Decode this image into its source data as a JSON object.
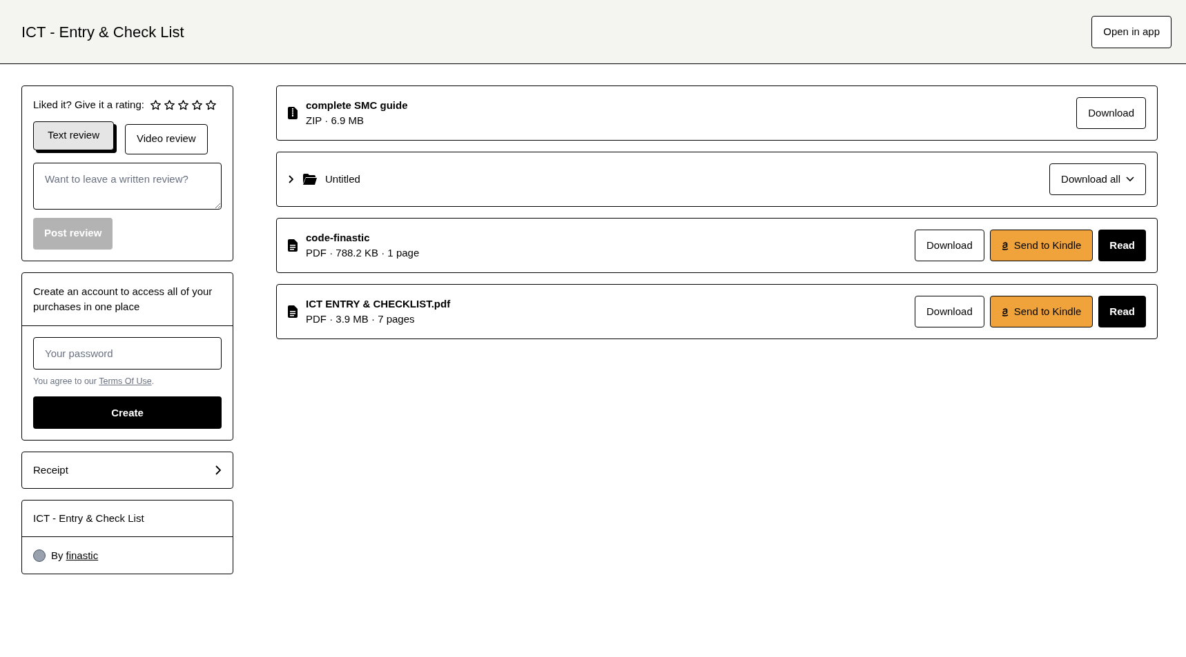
{
  "header": {
    "title": "ICT - Entry & Check List",
    "open_in_app": "Open in app"
  },
  "review": {
    "prompt": "Liked it? Give it a rating:",
    "stars": 0,
    "tabs": [
      {
        "label": "Text review",
        "selected": true
      },
      {
        "label": "Video review",
        "selected": false
      }
    ],
    "placeholder": "Want to leave a written review?",
    "post_button": {
      "label": "Post review",
      "disabled": true
    }
  },
  "account": {
    "text": "Create an account to access all of your purchases in one place",
    "password_placeholder": "Your password",
    "agree_text": "You agree to our",
    "terms_link": "Terms Of Use",
    "agree_end": ".",
    "create_button": "Create"
  },
  "receipt": {
    "label": "Receipt"
  },
  "product": {
    "title": "ICT - Entry & Check List",
    "by": "By",
    "author": "finastic"
  },
  "items": [
    {
      "kind": "archive",
      "name": "complete SMC guide",
      "meta": "ZIP · 6.9 MB",
      "buttons": [
        {
          "kind": "download",
          "label": "Download"
        }
      ]
    },
    {
      "kind": "folder",
      "name": "Untitled",
      "expanded": false,
      "buttons": [
        {
          "kind": "download_all",
          "label": "Download all"
        }
      ]
    },
    {
      "kind": "document",
      "name": "code-finastic",
      "meta": "PDF · 788.2 KB · 1 page",
      "buttons": [
        {
          "kind": "download",
          "label": "Download"
        },
        {
          "kind": "kindle",
          "label": "Send to Kindle"
        },
        {
          "kind": "read",
          "label": "Read"
        }
      ]
    },
    {
      "kind": "document",
      "name": "ICT ENTRY & CHECKLIST.pdf",
      "meta": "PDF · 3.9 MB · 7 pages",
      "buttons": [
        {
          "kind": "download",
          "label": "Download"
        },
        {
          "kind": "kindle",
          "label": "Send to Kindle"
        },
        {
          "kind": "read",
          "label": "Read"
        }
      ]
    }
  ]
}
